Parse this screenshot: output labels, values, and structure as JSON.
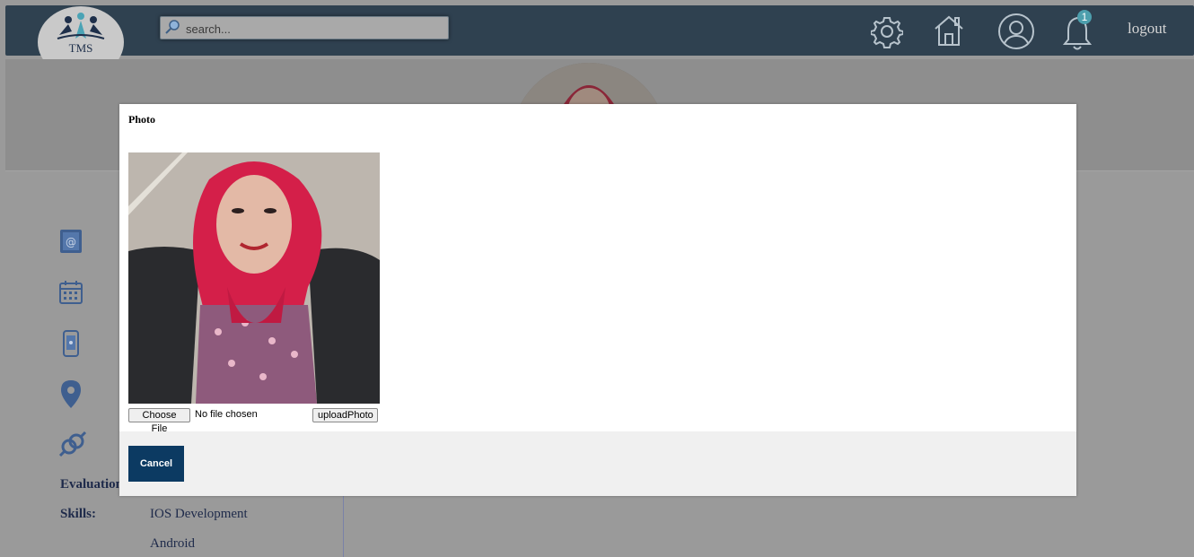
{
  "header": {
    "logo_text": "TMS",
    "search_placeholder": "search...",
    "notification_count": "1",
    "logout_label": "logout"
  },
  "profile": {
    "evaluation_label": "Evaluation",
    "skills_label": "Skills:",
    "skills": [
      "IOS Development",
      "Android"
    ]
  },
  "modal": {
    "title": "Photo",
    "choose_file_label": "Choose File",
    "file_status": "No file chosen",
    "upload_label": "uploadPhoto",
    "cancel_label": "Cancel"
  },
  "colors": {
    "header_bg": "#2f4150",
    "cancel_bg": "#0c3a62",
    "badge_bg": "#4d9fad",
    "icon_color": "#4a6fa8"
  }
}
